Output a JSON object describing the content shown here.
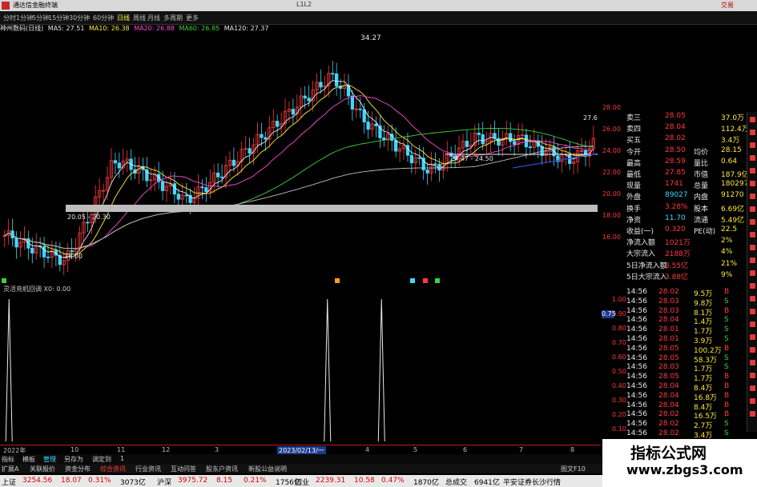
{
  "window": {
    "title": "通达信金融终端",
    "caption": "L1L2",
    "corner_label": "交易"
  },
  "toolbar": {
    "items": [
      "分时",
      "1分钟",
      "5分钟",
      "15分钟",
      "30分钟",
      "60分钟",
      "日线",
      "周线",
      "月线",
      "多周期",
      "更多"
    ],
    "active_index": 6
  },
  "legend": {
    "stock_label": "神州数码(日线)",
    "ma": [
      {
        "label": "MA5: 27.51",
        "color": "#e8e8e8"
      },
      {
        "label": "MA10: 26.38",
        "color": "#ffea3b"
      },
      {
        "label": "MA20: 26.88",
        "color": "#ff4bd8"
      },
      {
        "label": "MA60: 26.85",
        "color": "#3cd33c"
      },
      {
        "label": "MA120: 27.37",
        "color": "#e8e8e8"
      }
    ]
  },
  "price_chart": {
    "high_label": "34.27",
    "low_label": "18.00",
    "support_label": "20.05 - 20.30",
    "range_label": "24.47 - 24.50",
    "right_high_label": "27.6",
    "axis_ticks": [
      "28.00",
      "26.00",
      "24.00",
      "22.00",
      "20.00",
      "18.00",
      "16.00"
    ],
    "ohlc_range": [
      16,
      36
    ]
  },
  "indicator": {
    "label": "灵活充机回调 X0: 0.00",
    "axis_ticks": [
      "1.00",
      "0.90",
      "0.80",
      "0.70",
      "0.60",
      "0.50",
      "0.40",
      "0.30",
      "0.20",
      "0.10"
    ],
    "current_value": "0.75",
    "spike_positions": [
      0.015,
      0.545,
      0.635
    ]
  },
  "quote": {
    "rows": [
      {
        "k": "卖三",
        "v": "28.05",
        "k2": "",
        "v2": "37.0万"
      },
      {
        "k": "卖四",
        "v": "28.04",
        "k2": "",
        "v2": "112.4万"
      },
      {
        "k": "买五",
        "v": "28.02",
        "k2": "",
        "v2": "3.4万"
      },
      {
        "k": "今开",
        "v": "28.50",
        "k2": "均价",
        "v2": "28.15"
      },
      {
        "k": "最高",
        "v": "28.59",
        "k2": "量比",
        "v2": "0.64"
      },
      {
        "k": "最低",
        "v": "27.85",
        "k2": "市值",
        "v2": "187.9亿"
      },
      {
        "k": "现量",
        "v": "1741",
        "k2": "总量",
        "v2": "180297"
      },
      {
        "k": "外盘",
        "v": "89027",
        "k2": "内盘",
        "v2": "91270"
      },
      {
        "k": "换手",
        "v": "3.28%",
        "k2": "股本",
        "v2": "6.69亿"
      },
      {
        "k": "净资",
        "v": "11.70",
        "k2": "流通",
        "v2": "5.49亿"
      },
      {
        "k": "收益(一)",
        "v": "0.320",
        "k2": "PE(动)",
        "v2": "22.5"
      },
      {
        "k": "净流入额",
        "v": "1021万",
        "k2": "",
        "v2": "2%"
      },
      {
        "k": "大宗流入",
        "v": "2188万",
        "k2": "",
        "v2": "4%"
      },
      {
        "k": "5日净流入额",
        "v": "8.55亿",
        "k2": "",
        "v2": "21%"
      },
      {
        "k": "5日大宗流入",
        "v": "3.88亿",
        "k2": "",
        "v2": "9%"
      }
    ]
  },
  "trades": [
    {
      "t": "14:56",
      "p": "28.02",
      "v": "9.5万",
      "s": "B"
    },
    {
      "t": "14:56",
      "p": "28.03",
      "v": "9.8万",
      "s": "S"
    },
    {
      "t": "14:56",
      "p": "28.03",
      "v": "8.1万",
      "s": "B"
    },
    {
      "t": "14:56",
      "p": "28.04",
      "v": "1.4万",
      "s": "S"
    },
    {
      "t": "14:56",
      "p": "28.01",
      "v": "1.7万",
      "s": "S"
    },
    {
      "t": "14:56",
      "p": "28.01",
      "v": "3.9万",
      "s": "S"
    },
    {
      "t": "14:56",
      "p": "28.05",
      "v": "100.2万",
      "s": "B"
    },
    {
      "t": "14:56",
      "p": "28.05",
      "v": "58.3万",
      "s": "S"
    },
    {
      "t": "14:56",
      "p": "28.03",
      "v": "1.7万",
      "s": "S"
    },
    {
      "t": "14:56",
      "p": "28.05",
      "v": "1.7万",
      "s": "B"
    },
    {
      "t": "14:56",
      "p": "28.04",
      "v": "8.4万",
      "s": "B"
    },
    {
      "t": "14:56",
      "p": "28.04",
      "v": "16.8万",
      "s": "B"
    },
    {
      "t": "14:56",
      "p": "28.04",
      "v": "8.4万",
      "s": "B"
    },
    {
      "t": "14:56",
      "p": "28.02",
      "v": "16.5万",
      "s": "B"
    },
    {
      "t": "14:56",
      "p": "28.02",
      "v": "2.7万",
      "s": "S"
    },
    {
      "t": "14:56",
      "p": "28.02",
      "v": "3.4万",
      "s": "S"
    }
  ],
  "time_axis": {
    "labels": [
      "2022年",
      "10",
      "11",
      "12",
      "3",
      "2023/02/13/一",
      "4",
      "5",
      "6",
      "7",
      "8"
    ]
  },
  "tabs": {
    "row1": [
      "指标",
      "模板",
      "管理",
      "另存为",
      "调定到",
      "1"
    ],
    "row2": [
      "扩展A",
      "关联报价",
      "资金分布",
      "综合资讯",
      "行业资讯",
      "互动问答",
      "股东户资讯",
      "新股公益说明"
    ],
    "corner": "图文F10"
  },
  "status": {
    "items": [
      {
        "label": "上证",
        "value": "3254.56",
        "chg": "18.07",
        "pct": "0.31%",
        "amt": "3073亿"
      },
      {
        "label": "沪深",
        "value": "3975.72",
        "chg": "8.15",
        "pct": "0.21%",
        "amt": "1756亿"
      },
      {
        "label": "创业",
        "value": "2239.31",
        "chg": "10.58",
        "pct": "0.47%",
        "amt": "1870亿"
      }
    ],
    "total_label": "总成交",
    "total_value": "6941亿",
    "broker": "平安证券长沙行情"
  },
  "watermark": {
    "line1": "指标公式网",
    "line2": "www.zbgs3.com"
  }
}
